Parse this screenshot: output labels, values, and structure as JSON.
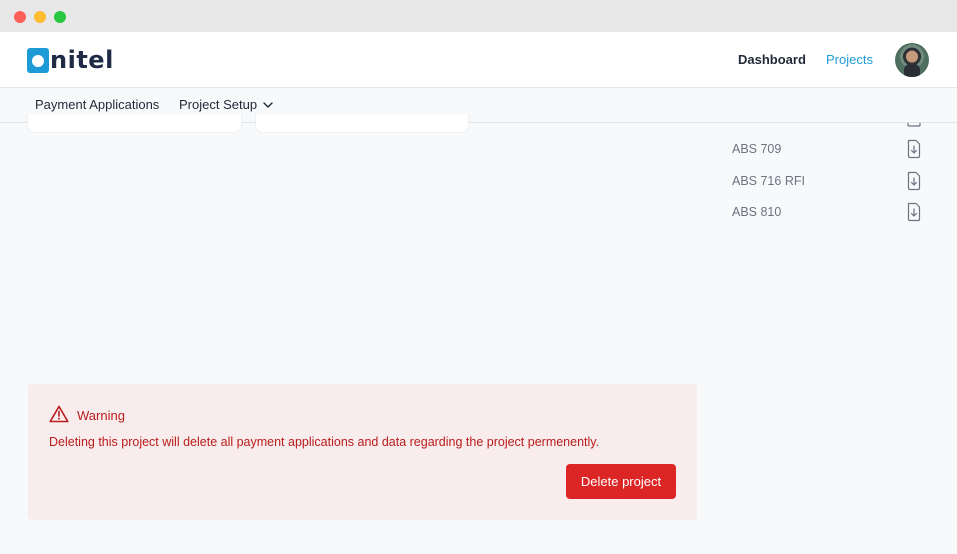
{
  "brand": {
    "logo_text": "nitel",
    "logo_color": "#1e9bd7"
  },
  "topnav": {
    "links": [
      {
        "label": "Dashboard",
        "active": false
      },
      {
        "label": "Projects",
        "active": true
      }
    ],
    "accent_color": "#1e9bd7"
  },
  "subnav": {
    "items": [
      {
        "label": "Payment Applications"
      },
      {
        "label": "Project Setup",
        "icon": "chevron-down-icon"
      }
    ]
  },
  "files": [
    {
      "name": "ABS 709",
      "icon": "file-download-icon"
    },
    {
      "name": "ABS 716 RFI",
      "icon": "file-download-icon"
    },
    {
      "name": "ABS 810",
      "icon": "file-download-icon"
    }
  ],
  "warning": {
    "title": "Warning",
    "message": "Deleting this project will delete all payment applications and data regarding the project permenently.",
    "icon": "warning-triangle-icon",
    "button_label": "Delete project",
    "danger_color": "#dc2626"
  }
}
